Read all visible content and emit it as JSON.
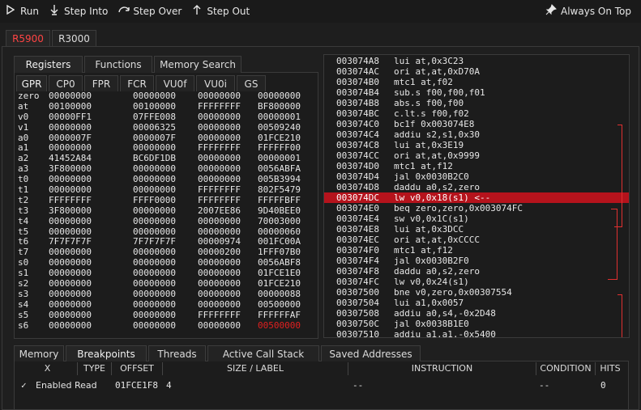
{
  "toolbar": {
    "run": "Run",
    "step_into": "Step Into",
    "step_over": "Step Over",
    "step_out": "Step Out",
    "always_on_top": "Always On Top"
  },
  "cpu_tabs": [
    "R5900",
    "R3000"
  ],
  "left_tabs": [
    "Registers",
    "Functions",
    "Memory Search"
  ],
  "reg_tabs": [
    "GPR",
    "CP0",
    "FPR",
    "FCR",
    "VU0f",
    "VU0i",
    "GS"
  ],
  "registers": [
    {
      "name": "zero",
      "v": [
        "00000000",
        "00000000",
        "00000000",
        "00000000"
      ]
    },
    {
      "name": "at",
      "v": [
        "00100000",
        "00100000",
        "FFFFFFFF",
        "BF800000"
      ]
    },
    {
      "name": "v0",
      "v": [
        "00000FF1",
        "07FFE008",
        "00000000",
        "00000001"
      ]
    },
    {
      "name": "v1",
      "v": [
        "00000000",
        "00006325",
        "00000000",
        "00509240"
      ]
    },
    {
      "name": "a0",
      "v": [
        "0000007F",
        "0000007F",
        "00000000",
        "01FCE210"
      ]
    },
    {
      "name": "a1",
      "v": [
        "00000000",
        "00000000",
        "FFFFFFFF",
        "FFFFFF00"
      ]
    },
    {
      "name": "a2",
      "v": [
        "41452A84",
        "BC6DF1DB",
        "00000000",
        "00000001"
      ]
    },
    {
      "name": "a3",
      "v": [
        "3F800000",
        "00000000",
        "00000000",
        "0056ABFA"
      ]
    },
    {
      "name": "t0",
      "v": [
        "00000000",
        "00000000",
        "00000000",
        "005B3994"
      ]
    },
    {
      "name": "t1",
      "v": [
        "00000000",
        "00000000",
        "FFFFFFFF",
        "802F5479"
      ]
    },
    {
      "name": "t2",
      "v": [
        "FFFFFFFF",
        "FFFF0000",
        "FFFFFFFF",
        "FFFFFBFF"
      ]
    },
    {
      "name": "t3",
      "v": [
        "3F800000",
        "00000000",
        "2007EE86",
        "9D40BEE0"
      ]
    },
    {
      "name": "t4",
      "v": [
        "00000000",
        "00000000",
        "00000000",
        "70003000"
      ]
    },
    {
      "name": "t5",
      "v": [
        "00000000",
        "00000000",
        "00000000",
        "00000060"
      ]
    },
    {
      "name": "t6",
      "v": [
        "7F7F7F7F",
        "7F7F7F7F",
        "00000974",
        "001FC00A"
      ]
    },
    {
      "name": "t7",
      "v": [
        "00000000",
        "00000000",
        "00000200",
        "1FFF07B0"
      ]
    },
    {
      "name": "s0",
      "v": [
        "00000000",
        "00000000",
        "00000000",
        "0056ABF8"
      ]
    },
    {
      "name": "s1",
      "v": [
        "00000000",
        "00000000",
        "00000000",
        "01FCE1E0"
      ]
    },
    {
      "name": "s2",
      "v": [
        "00000000",
        "00000000",
        "00000000",
        "01FCE210"
      ]
    },
    {
      "name": "s3",
      "v": [
        "00000000",
        "00000000",
        "00000000",
        "00000088"
      ]
    },
    {
      "name": "s4",
      "v": [
        "00000000",
        "00000000",
        "00000000",
        "00500000"
      ]
    },
    {
      "name": "s5",
      "v": [
        "00000000",
        "00000000",
        "FFFFFFFF",
        "FFFFFFAF"
      ]
    },
    {
      "name": "s6",
      "v": [
        "00000000",
        "00000000",
        "00000000",
        "00500000"
      ],
      "changed": [
        3
      ]
    }
  ],
  "disassembly": [
    {
      "addr": "003074A8",
      "ins": "lui at,0x3C23"
    },
    {
      "addr": "003074AC",
      "ins": "ori at,at,0xD70A"
    },
    {
      "addr": "003074B0",
      "ins": "mtc1 at,f02"
    },
    {
      "addr": "003074B4",
      "ins": "sub.s f00,f00,f01"
    },
    {
      "addr": "003074B8",
      "ins": "abs.s f00,f00"
    },
    {
      "addr": "003074BC",
      "ins": "c.lt.s f00,f02"
    },
    {
      "addr": "003074C0",
      "ins": "bc1f 0x003074E8"
    },
    {
      "addr": "003074C4",
      "ins": "addiu s2,s1,0x30"
    },
    {
      "addr": "003074C8",
      "ins": "lui at,0x3E19"
    },
    {
      "addr": "003074CC",
      "ins": "ori at,at,0x9999"
    },
    {
      "addr": "003074D0",
      "ins": "mtc1 at,f12"
    },
    {
      "addr": "003074D4",
      "ins": "jal 0x0030B2C0"
    },
    {
      "addr": "003074D8",
      "ins": "daddu a0,s2,zero"
    },
    {
      "addr": "003074DC",
      "ins": "lw v0,0x18(s1)   <--"
    },
    {
      "addr": "003074E0",
      "ins": "beq zero,zero,0x003074FC"
    },
    {
      "addr": "003074E4",
      "ins": "sw v0,0x1C(s1)"
    },
    {
      "addr": "003074E8",
      "ins": "lui at,0x3DCC"
    },
    {
      "addr": "003074EC",
      "ins": "ori at,at,0xCCCC"
    },
    {
      "addr": "003074F0",
      "ins": "mtc1 at,f12"
    },
    {
      "addr": "003074F4",
      "ins": "jal 0x0030B2F0"
    },
    {
      "addr": "003074F8",
      "ins": "daddu a0,s2,zero"
    },
    {
      "addr": "003074FC",
      "ins": "lw v0,0x24(s1)"
    },
    {
      "addr": "00307500",
      "ins": "bne v0,zero,0x00307554"
    },
    {
      "addr": "00307504",
      "ins": "lui a1,0x0057"
    },
    {
      "addr": "00307508",
      "ins": "addiu a0,s4,-0x2D48"
    },
    {
      "addr": "0030750C",
      "ins": "jal 0x0038B1E0"
    },
    {
      "addr": "00307510",
      "ins": "addiu a1,a1,-0x5400"
    }
  ],
  "current_pc_index": 13,
  "bottom_tabs": [
    "Memory",
    "Breakpoints",
    "Threads",
    "Active Call Stack",
    "Saved Addresses"
  ],
  "bp_headers": [
    "X",
    "TYPE",
    "OFFSET",
    "SIZE / LABEL",
    "INSTRUCTION",
    "CONDITION",
    "HITS"
  ],
  "breakpoints": [
    {
      "check": "✓",
      "type": "Enabled Read",
      "offset": "01FCE1F8",
      "size": "4",
      "instruction": "--",
      "condition": "--",
      "hits": "0"
    }
  ],
  "colors": {
    "accent_red": "#b5131c",
    "changed_value": "#e02020"
  }
}
